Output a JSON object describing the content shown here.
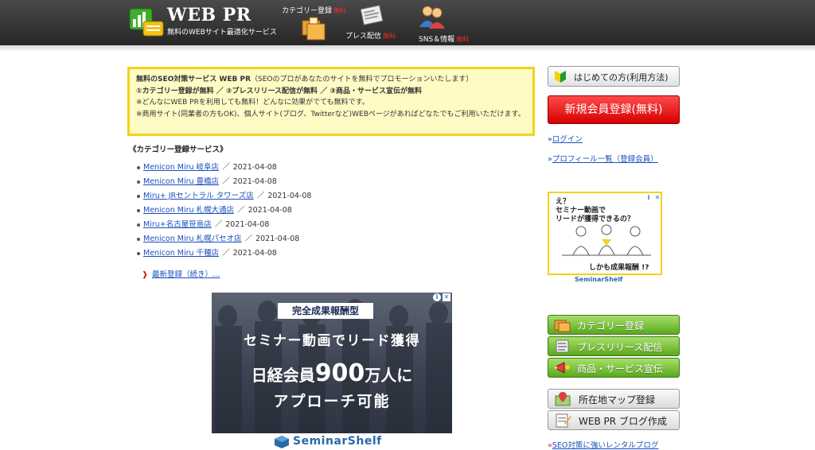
{
  "header": {
    "logo_title": "WEB PR",
    "logo_subtitle": "無料のWEBサイト最適化サービス",
    "nav": [
      {
        "label": "カテゴリー登録",
        "badge": "無料"
      },
      {
        "label": "プレス配信",
        "badge": "無料"
      },
      {
        "label": "SNS＆情報",
        "badge": "無料"
      }
    ]
  },
  "intro": {
    "line1_bold": "無料のSEO対策サービス WEB PR",
    "line1_rest": "（SEOのプロがあなたのサイトを無料でプロモーションいたします）",
    "line2": "①カテゴリー登録が無料 ／ ②プレスリリース配信が無料 ／ ③商品・サービス宣伝が無料",
    "line3": "※どんなにWEB PRを利用しても無料！どんなに効果がでても無料です。",
    "line4": "※商用サイト(同業者の方もOK)、個人サイト(ブログ、Twitterなど)WEBページがあればどなたでもご利用いただけます。"
  },
  "main": {
    "section_title": "《カテゴリー登録サービス》",
    "separator": "／",
    "entries": [
      {
        "name": "Menicon Miru 岐阜店",
        "date": "2021-04-08"
      },
      {
        "name": "Menicon Miru 豊橋店",
        "date": "2021-04-08"
      },
      {
        "name": "Miru+ JRセントラル タワーズ店",
        "date": "2021-04-08"
      },
      {
        "name": "Menicon Miru 札幌大通店",
        "date": "2021-04-08"
      },
      {
        "name": "Miru+名古屋笹島店",
        "date": "2021-04-08"
      },
      {
        "name": "Menicon Miru 札幌パセオ店",
        "date": "2021-04-08"
      },
      {
        "name": "Menicon Miru 千種店",
        "date": "2021-04-08"
      }
    ],
    "more_arrow": "❱",
    "more_label": "最新登録（続き）…"
  },
  "ad_main": {
    "badge": "完全成果報酬型",
    "line1": "セミナー動画でリード獲得",
    "line2_pre": "日経会員",
    "line2_big": "900",
    "line2_post": "万人に",
    "line3": "アプローチ可能",
    "logo": "SeminarShelf",
    "close_icon": "✕",
    "info_icon": "i"
  },
  "sidebar": {
    "first_time": "はじめての方(利用方法)",
    "register": "新規会員登録(無料)",
    "link_marker": "»",
    "login": "ログイン",
    "profiles": "プロフィール一覧（登録会員）",
    "ad": {
      "t1": "え？",
      "t2": "セミナー動画で",
      "t3": "リードが獲得できるの？",
      "t4": "しかも成果報酬 !?",
      "logo": "SeminarShelf"
    },
    "category": "カテゴリー登録",
    "press": "プレスリリース配信",
    "product": "商品・サービス宣伝",
    "map": "所在地マップ登録",
    "blog": "WEB PR ブログ作成",
    "seo_marker": "»",
    "seo_blog": "SEO対策に強いレンタルブログ"
  },
  "colors": {
    "header_bg": "#333333",
    "accent_yellow": "#f3d21a",
    "register_red": "#e00000",
    "nav_green": "#6fbf2a",
    "link_blue": "#1a4fbf"
  }
}
